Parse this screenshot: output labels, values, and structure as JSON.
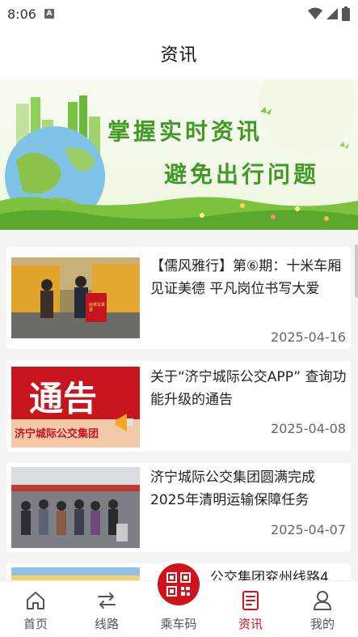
{
  "status_bar": {
    "time": "8:06",
    "notification_icon": "A"
  },
  "header": {
    "title": "资讯"
  },
  "banner": {
    "line1": "掌握实时资讯",
    "line2": "避免出行问题"
  },
  "news": [
    {
      "title": "【儒风雅行】第⑥期：十米车厢见证美德 平凡岗位书写大爱",
      "date": "2025-04-16",
      "thumb_banner_text": "给乘车乘客"
    },
    {
      "title": "关于“济宁城际公交APP” 查询功能升级的通告",
      "date": "2025-04-08",
      "thumb_text_main": "通告",
      "thumb_text_sub": "济宁城际公交集团"
    },
    {
      "title": "济宁城际公交集团圆满完成2025年清明运输保障任务",
      "date": "2025-04-07"
    },
    {
      "title": "公交集团兖州线路4",
      "date": ""
    }
  ],
  "bottom_nav": {
    "items": [
      {
        "label": "首页",
        "icon": "home-icon"
      },
      {
        "label": "线路",
        "icon": "route-icon"
      },
      {
        "label": "乘车码",
        "icon": "qr-code-icon"
      },
      {
        "label": "资讯",
        "icon": "news-icon"
      },
      {
        "label": "我的",
        "icon": "user-icon"
      }
    ],
    "active": "资讯"
  },
  "colors": {
    "brand_red": "#d0121b",
    "banner_green": "#3f9a1f"
  }
}
